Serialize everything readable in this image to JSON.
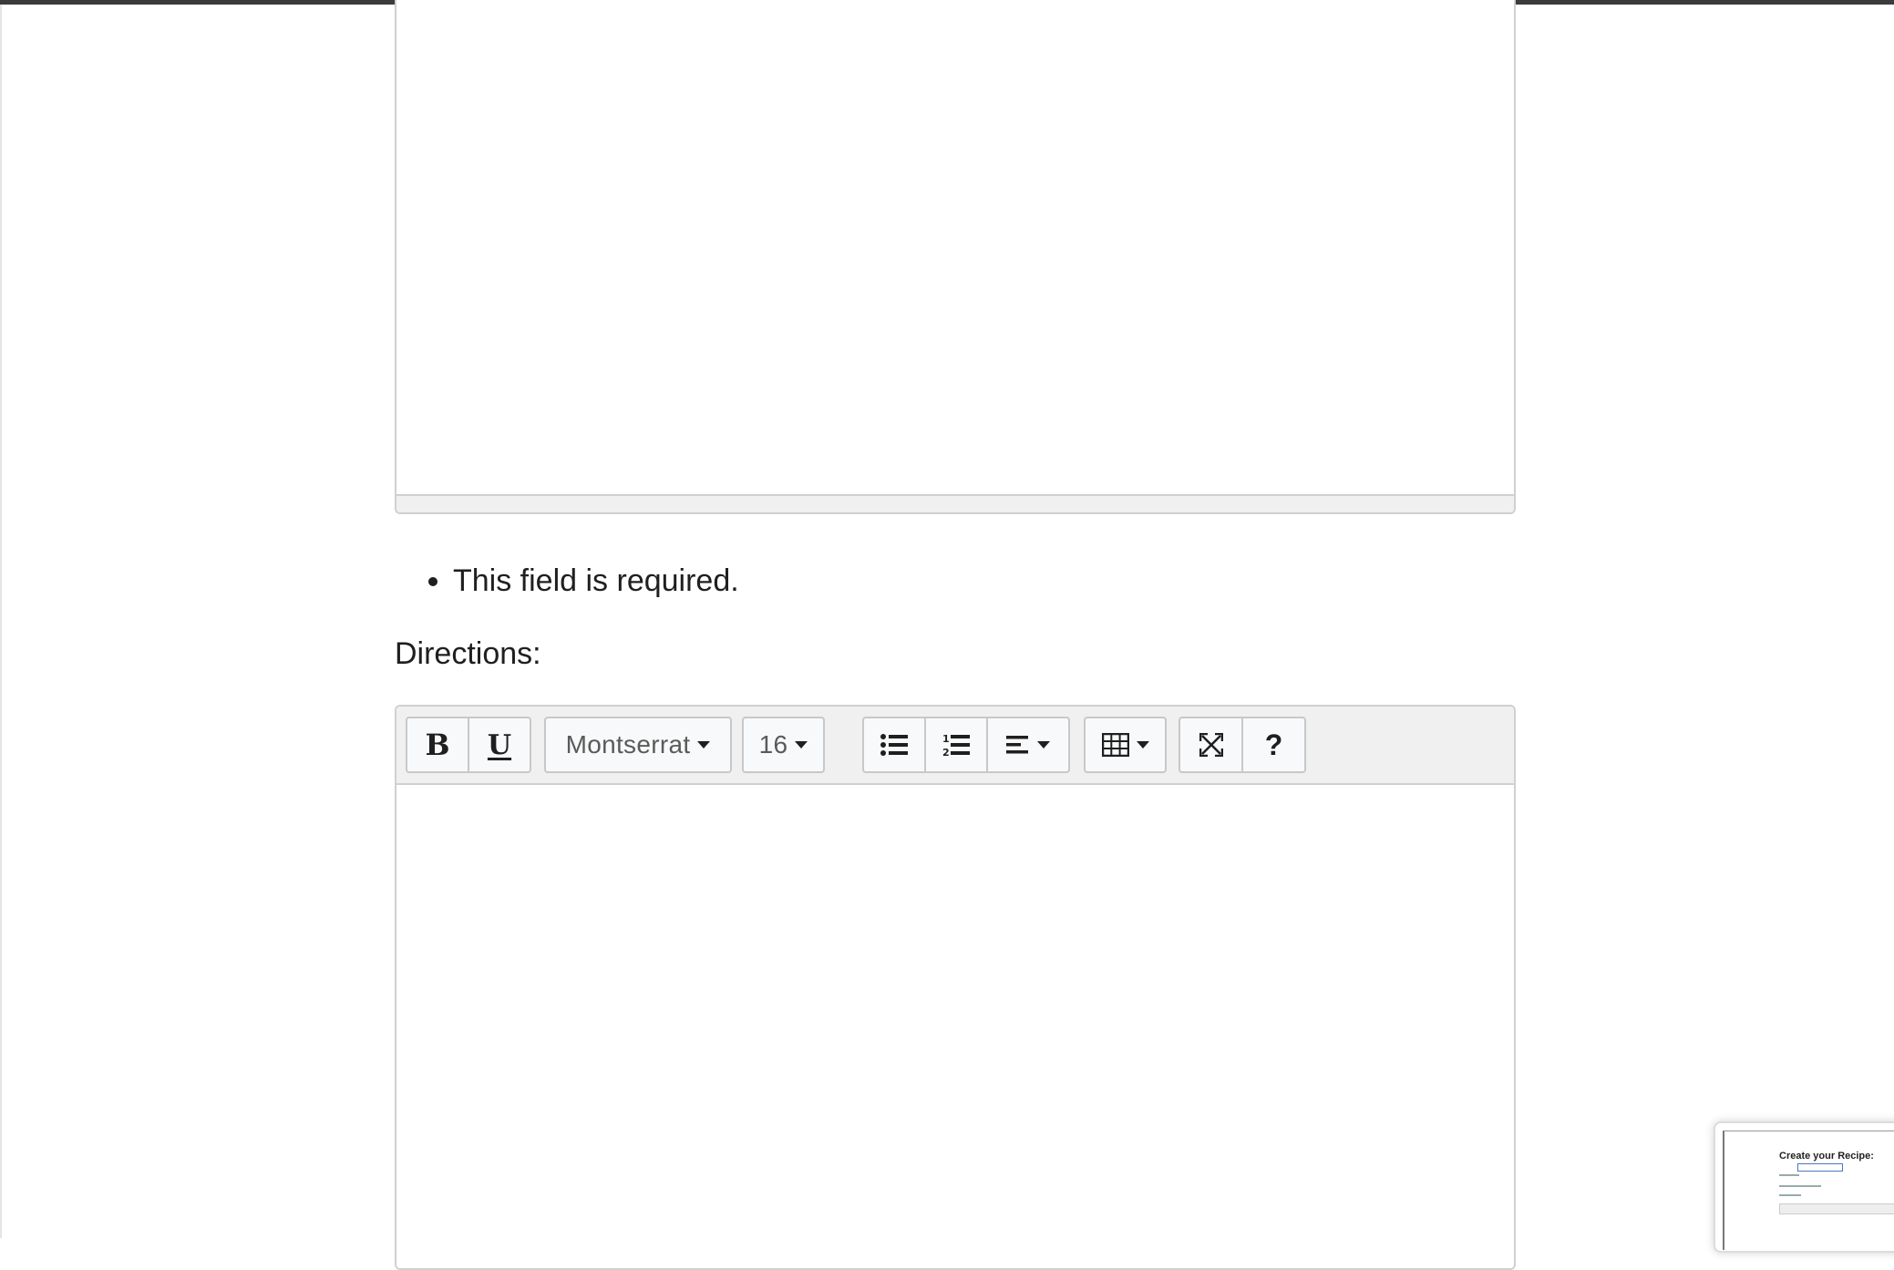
{
  "upper_editor": {
    "content": ""
  },
  "validation": {
    "errors": [
      "This field is required."
    ]
  },
  "directions": {
    "label": "Directions:",
    "content": "",
    "toolbar": {
      "bold": "B",
      "underline": "U",
      "font_family": "Montserrat",
      "font_size": "16",
      "help": "?"
    }
  },
  "thumbnail": {
    "title": "Create your Recipe:"
  },
  "icons": {
    "bold": "bold-icon",
    "underline": "underline-icon",
    "unordered_list": "unordered-list-icon",
    "ordered_list": "ordered-list-icon",
    "align": "align-left-icon",
    "table": "table-icon",
    "fullscreen": "fullscreen-icon",
    "help": "help-icon"
  },
  "colors": {
    "toolbar_bg": "#f0f0f0",
    "border": "#d0d0d0",
    "button_bg": "#f8f9fa",
    "text": "#1f1f1f"
  }
}
